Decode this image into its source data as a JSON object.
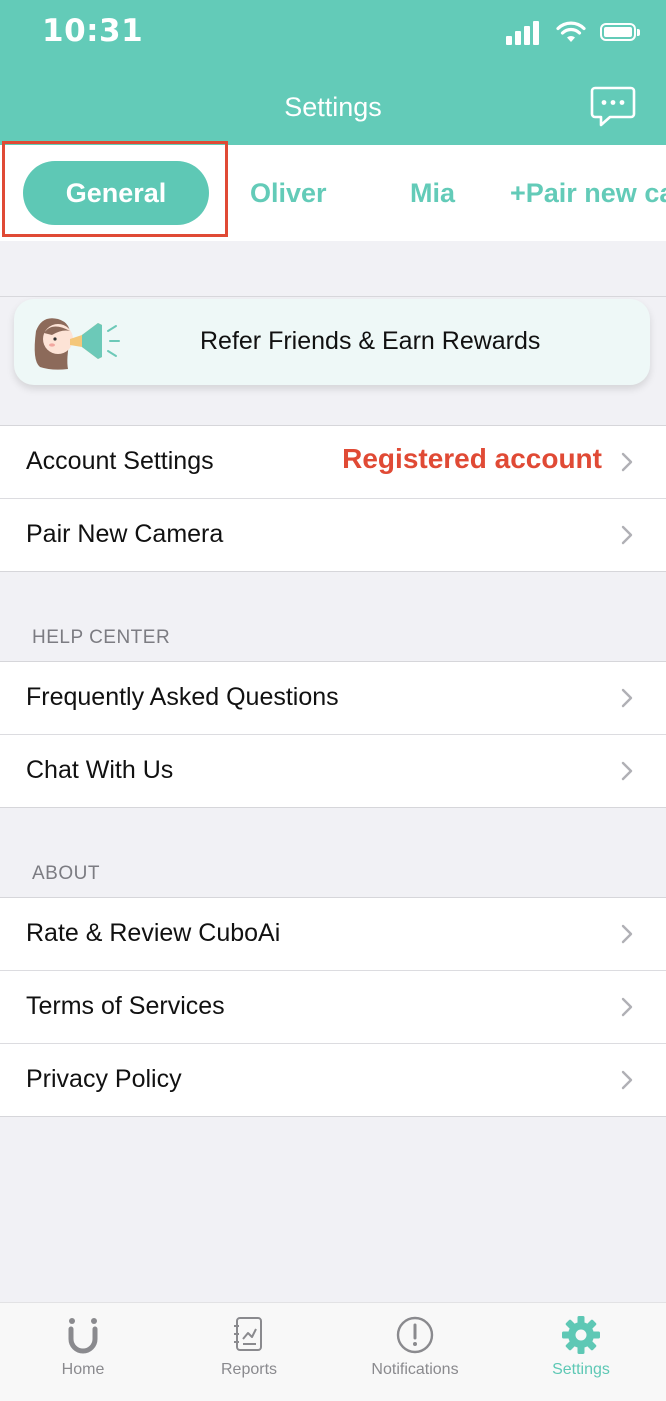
{
  "status_bar": {
    "time": "10:31"
  },
  "header": {
    "title": "Settings",
    "chat_icon": "chat-bubble-icon"
  },
  "tabs": [
    {
      "label": "General",
      "active": true
    },
    {
      "label": "Oliver",
      "active": false
    },
    {
      "label": "Mia",
      "active": false
    },
    {
      "label": "+Pair new ca",
      "active": false
    }
  ],
  "banner": {
    "text": "Refer Friends & Earn Rewards"
  },
  "account_group": {
    "rows": [
      {
        "label": "Account Settings",
        "value": "Registered account"
      },
      {
        "label": "Pair New Camera"
      }
    ]
  },
  "help_center": {
    "header": "HELP CENTER",
    "rows": [
      {
        "label": "Frequently Asked Questions"
      },
      {
        "label": "Chat With Us"
      }
    ]
  },
  "about": {
    "header": "ABOUT",
    "rows": [
      {
        "label": "Rate & Review CuboAi"
      },
      {
        "label": "Terms of Services"
      },
      {
        "label": "Privacy Policy"
      }
    ]
  },
  "tab_bar": {
    "items": [
      {
        "label": "Home",
        "icon": "home-u-icon"
      },
      {
        "label": "Reports",
        "icon": "reports-icon"
      },
      {
        "label": "Notifications",
        "icon": "notification-alert-icon"
      },
      {
        "label": "Settings",
        "icon": "gear-icon",
        "active": true
      }
    ]
  },
  "colors": {
    "brand": "#63cbb8",
    "highlight": "#e04a35",
    "value_text": "#e04a35"
  }
}
